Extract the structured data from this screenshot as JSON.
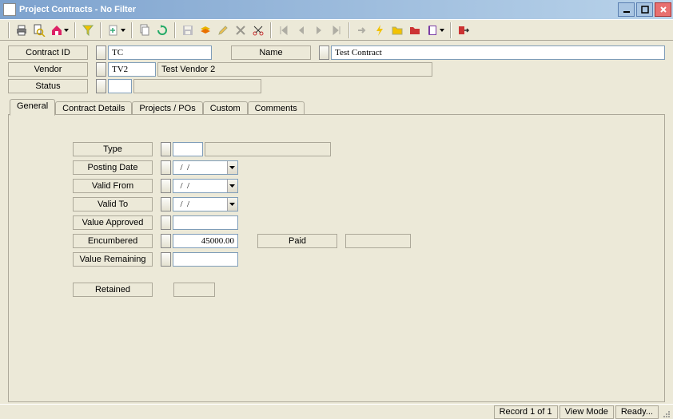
{
  "window": {
    "title": "Project Contracts - No Filter"
  },
  "header": {
    "contract_id_label": "Contract ID",
    "contract_id": "TC",
    "name_label": "Name",
    "name": "Test Contract",
    "vendor_label": "Vendor",
    "vendor_code": "TV2",
    "vendor_name": "Test Vendor 2",
    "status_label": "Status",
    "status_code": "",
    "status_text": ""
  },
  "tabs": [
    {
      "label": "General",
      "active": true
    },
    {
      "label": "Contract Details"
    },
    {
      "label": "Projects / POs"
    },
    {
      "label": "Custom"
    },
    {
      "label": "Comments"
    }
  ],
  "general": {
    "type_label": "Type",
    "type_code": "",
    "type_desc": "",
    "posting_date_label": "Posting Date",
    "posting_date": "  /  /",
    "valid_from_label": "Valid From",
    "valid_from": "  /  /",
    "valid_to_label": "Valid To",
    "valid_to": "  /  /",
    "value_approved_label": "Value Approved",
    "value_approved": "",
    "encumbered_label": "Encumbered",
    "encumbered": "45000.00",
    "paid_label": "Paid",
    "paid": "",
    "value_remaining_label": "Value Remaining",
    "value_remaining": "",
    "retained_label": "Retained",
    "retained": ""
  },
  "statusbar": {
    "record": "Record 1 of 1",
    "mode": "View Mode",
    "state": "Ready..."
  }
}
